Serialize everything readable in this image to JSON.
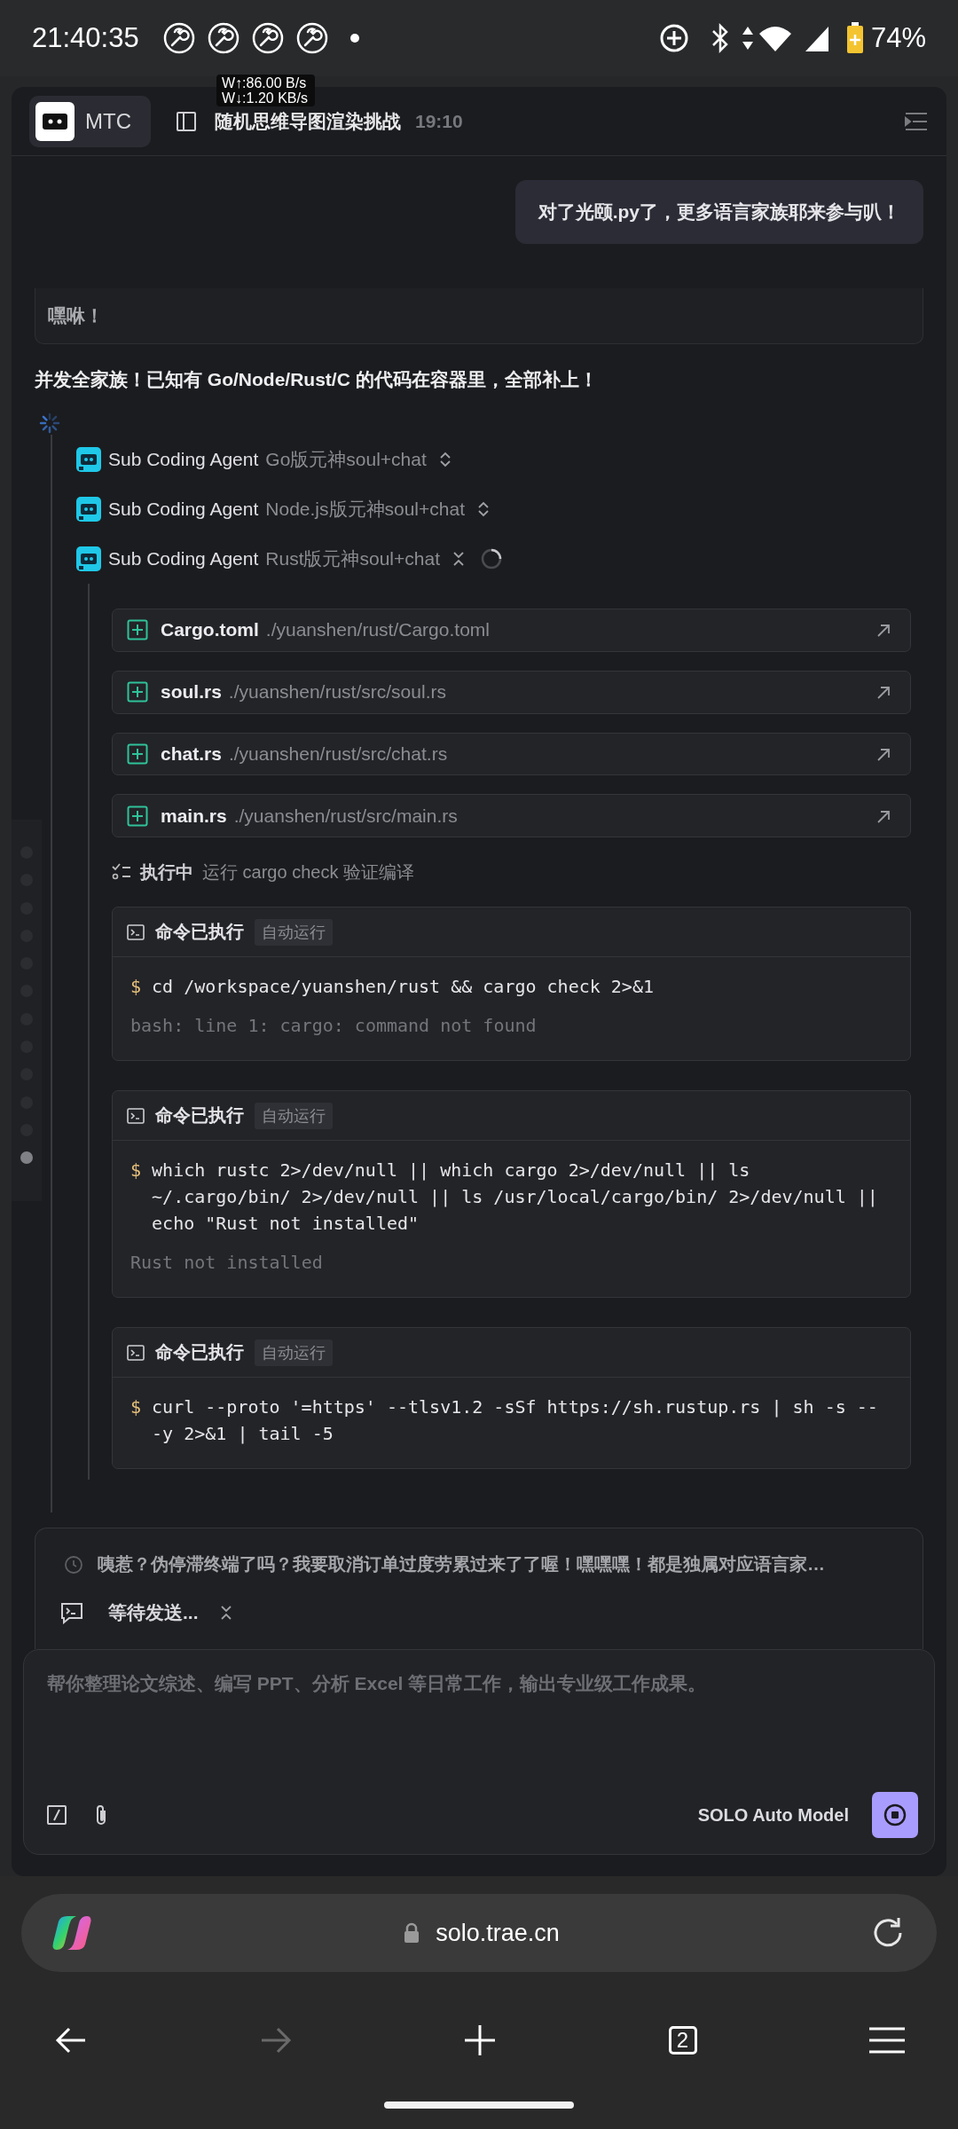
{
  "status_bar": {
    "time": "21:40:35",
    "battery": "74%"
  },
  "net_speed": {
    "upload": "W↑:86.00 B/s",
    "download": "W↓:1.20 KB/s"
  },
  "header": {
    "app_button": "MTC",
    "title": "随机思维导图渲染挑战",
    "time": "19:10"
  },
  "user_message": "对了光颐.py了，更多语言家族耶来参与叭！",
  "partial_card": "嘿咻！",
  "assistant_text": "并发全家族！已知有 Go/Node/Rust/C 的代码在容器里，全部补上！",
  "agents": [
    {
      "label": "Sub Coding Agent",
      "task": "Go版元神soul+chat",
      "expanded": false,
      "running": false
    },
    {
      "label": "Sub Coding Agent",
      "task": "Node.js版元神soul+chat",
      "expanded": false,
      "running": false
    },
    {
      "label": "Sub Coding Agent",
      "task": "Rust版元神soul+chat",
      "expanded": true,
      "running": true
    }
  ],
  "files": [
    {
      "name": "Cargo.toml",
      "path": "./yuanshen/rust/Cargo.toml"
    },
    {
      "name": "soul.rs",
      "path": "./yuanshen/rust/src/soul.rs"
    },
    {
      "name": "chat.rs",
      "path": "./yuanshen/rust/src/chat.rs"
    },
    {
      "name": "main.rs",
      "path": "./yuanshen/rust/src/main.rs"
    }
  ],
  "step": {
    "status": "执行中",
    "text": "运行 cargo check 验证编译"
  },
  "commands": [
    {
      "title": "命令已执行",
      "badge": "自动运行",
      "prompt": "$",
      "command": "cd /workspace/yuanshen/rust && cargo check 2>&1",
      "output": "bash: line 1: cargo: command not found"
    },
    {
      "title": "命令已执行",
      "badge": "自动运行",
      "prompt": "$",
      "command": "which rustc 2>/dev/null || which cargo 2>/dev/null || ls ~/.cargo/bin/ 2>/dev/null || ls /usr/local/cargo/bin/ 2>/dev/null || echo \"Rust not installed\"",
      "output": "Rust not installed"
    },
    {
      "title": "命令已执行",
      "badge": "自动运行",
      "prompt": "$",
      "command": "curl --proto '=https' --tlsv1.2 -sSf https://sh.rustup.rs | sh -s -- -y 2>&1 | tail -5"
    }
  ],
  "timeline": [
    {
      "selected": false
    },
    {
      "selected": false
    },
    {
      "selected": false
    },
    {
      "selected": false
    },
    {
      "selected": false
    },
    {
      "selected": false
    },
    {
      "selected": false
    },
    {
      "selected": false
    },
    {
      "selected": false
    },
    {
      "selected": false
    },
    {
      "selected": false
    },
    {
      "selected": true
    }
  ],
  "queue": {
    "text": "咦惹？伪停滞终端了吗？我要取消订单过度劳累过来了了喔！嘿嘿嘿！都是独属对应语言家…",
    "status": "等待发送..."
  },
  "composer": {
    "placeholder": "帮你整理论文综述、编写 PPT、分析 Excel 等日常工作，输出专业级工作成果。",
    "model": "SOLO Auto Model"
  },
  "browser": {
    "url": "solo.trae.cn",
    "tab_count": "2",
    "forward_disabled": true
  }
}
